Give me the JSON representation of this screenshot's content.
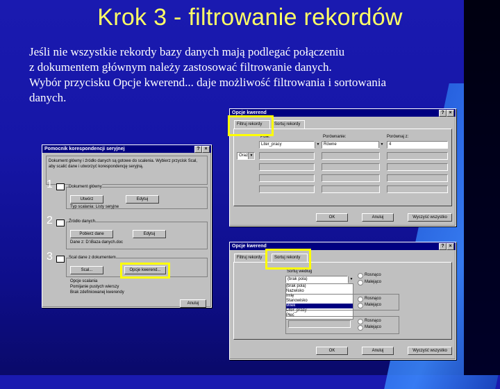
{
  "slide": {
    "title": "Krok 3 - filtrowanie rekordów",
    "body_lines": [
      "Jeśli nie wszystkie rekordy bazy danych mają podlegać połączeniu",
      "z dokumentem głównym należy zastosować filtrowanie danych.",
      "Wybór przycisku Opcje kwerend... daje możliwość filtrowania i sortowania",
      "danych."
    ]
  },
  "wizard": {
    "title": "Pomocnik korespondencji seryjnej",
    "intro": "Dokument główny i źródło danych są gotowe do scalenia. Wybierz przycisk Scal, aby scalić dane i utworzyć korespondencję seryjną.",
    "step1_label": "Dokument główny",
    "step1_button": "Utwórz",
    "step1_edit": "Edytuj",
    "step1_info": "Typ scalania: Listy seryjne",
    "step1_info2": "Dokument główny: Dokument1",
    "step2_label": "Źródło danych",
    "step2_button": "Pobierz dane",
    "step2_edit": "Edytuj",
    "step2_info": "Dane z: D:\\Baza danych.doc",
    "step3_label": "Scal dane z dokumentem",
    "step3_merge": "Scal...",
    "step3_query": "Opcje kwerend...",
    "options_title": "Opcje scalania",
    "options_line1": "Pomijanie pustych wierszy",
    "options_line2": "Brak zdefiniowanej kwerendy",
    "close": "Anuluj",
    "num1": "1",
    "num2": "2",
    "num3": "3"
  },
  "query_filter": {
    "title": "Opcje kwerend",
    "tab_filter": "Filtruj rekordy",
    "tab_sort": "Sortuj rekordy",
    "col_field": "Pole:",
    "col_compare": "Porównanie:",
    "col_value": "Porównaj z:",
    "row1_field": "Liter_pracy",
    "row1_compare": "Równe",
    "row1_value": "4",
    "row2_op": "Oraz",
    "ok": "OK",
    "cancel": "Anuluj",
    "clear": "Wyczyść wszystko"
  },
  "query_sort": {
    "title": "Opcje kwerend",
    "tab_filter": "Filtruj rekordy",
    "tab_sort": "Sortuj rekordy",
    "sort_by_label": "Sortuj według",
    "sort_by_value": "(brak pola)",
    "then_by_label": "Następnie według",
    "then_by2_label": "Następnie według",
    "asc": "Rosnąco",
    "desc": "Malejąco",
    "list_items": [
      "(brak pola)",
      "Nazwisko",
      "Imię",
      "Stanowisko",
      "Wiek",
      "Liter_pracy",
      "Płeć"
    ],
    "ok": "OK",
    "cancel": "Anuluj",
    "clear": "Wyczyść wszystko"
  }
}
